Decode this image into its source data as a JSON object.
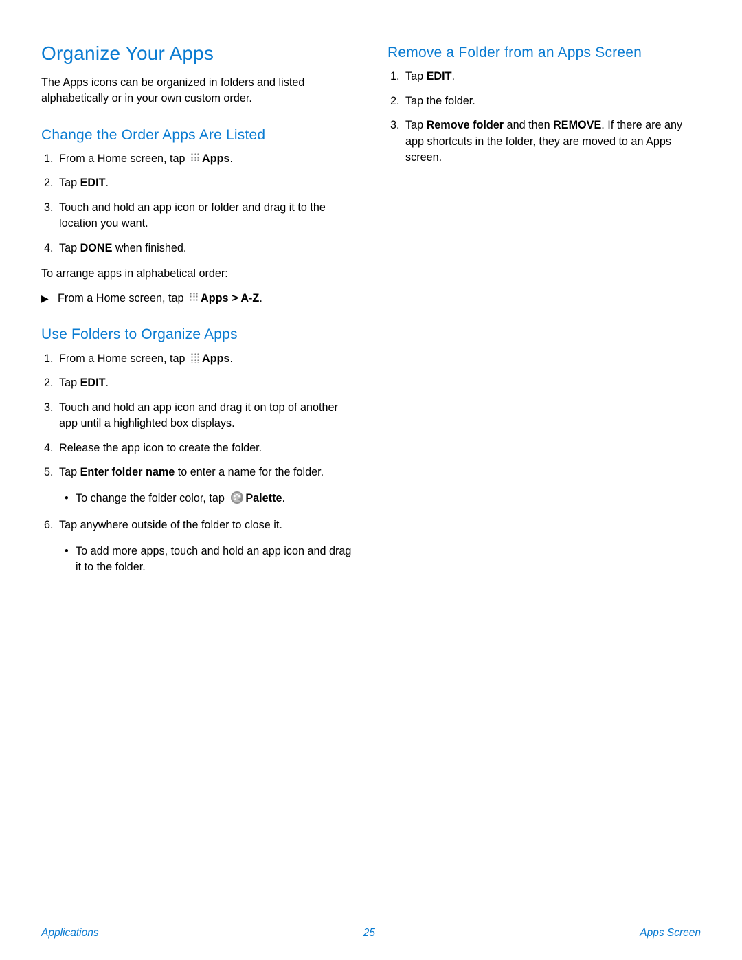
{
  "accent_color": "#0a7bd1",
  "title": "Organize Your Apps",
  "intro": "The Apps icons can be organized in folders and listed alphabetically or in your own custom order.",
  "icons": {
    "apps_label": "Apps",
    "palette_label": "Palette"
  },
  "section_change_order": {
    "heading": "Change the Order Apps Are Listed",
    "steps": {
      "s1_prefix": "From a Home screen, tap ",
      "s1_suffix": ".",
      "s2_pre": "Tap ",
      "s2_bold": "EDIT",
      "s2_post": ".",
      "s3": "Touch and hold an app icon or folder and drag it to the location you want.",
      "s4_pre": "Tap ",
      "s4_bold": "DONE",
      "s4_post": " when finished."
    },
    "alpha_intro": "To arrange apps in alphabetical order:",
    "alpha_item_prefix": "From a Home screen, tap ",
    "alpha_item_bold": "Apps > A-Z",
    "alpha_item_suffix": "."
  },
  "section_use_folders": {
    "heading": "Use Folders to Organize Apps",
    "steps": {
      "s1_prefix": "From a Home screen, tap ",
      "s1_suffix": ".",
      "s2_pre": "Tap ",
      "s2_bold": "EDIT",
      "s2_post": ".",
      "s3": "Touch and hold an app icon and drag it on top of another app until a highlighted box displays.",
      "s4": "Release the app icon to create the folder.",
      "s5_pre": "Tap ",
      "s5_bold": "Enter folder name",
      "s5_post": " to enter a name for the folder.",
      "s5_sub_pre": "To change the folder color, tap ",
      "s5_sub_post": ".",
      "s6": "Tap anywhere outside of the folder to close it.",
      "s6_sub": "To add more apps, touch and hold an app icon and drag it to the folder."
    }
  },
  "section_remove_folder": {
    "heading": "Remove a Folder from an Apps Screen",
    "steps": {
      "s1_pre": "Tap ",
      "s1_bold": "EDIT",
      "s1_post": ".",
      "s2": "Tap the folder.",
      "s3_pre": "Tap ",
      "s3_bold1": "Remove folder",
      "s3_mid": " and then ",
      "s3_bold2": "REMOVE",
      "s3_post": ". If there are any app shortcuts in the folder, they are moved to an Apps screen."
    }
  },
  "footer": {
    "left": "Applications",
    "center": "25",
    "right": "Apps Screen"
  }
}
